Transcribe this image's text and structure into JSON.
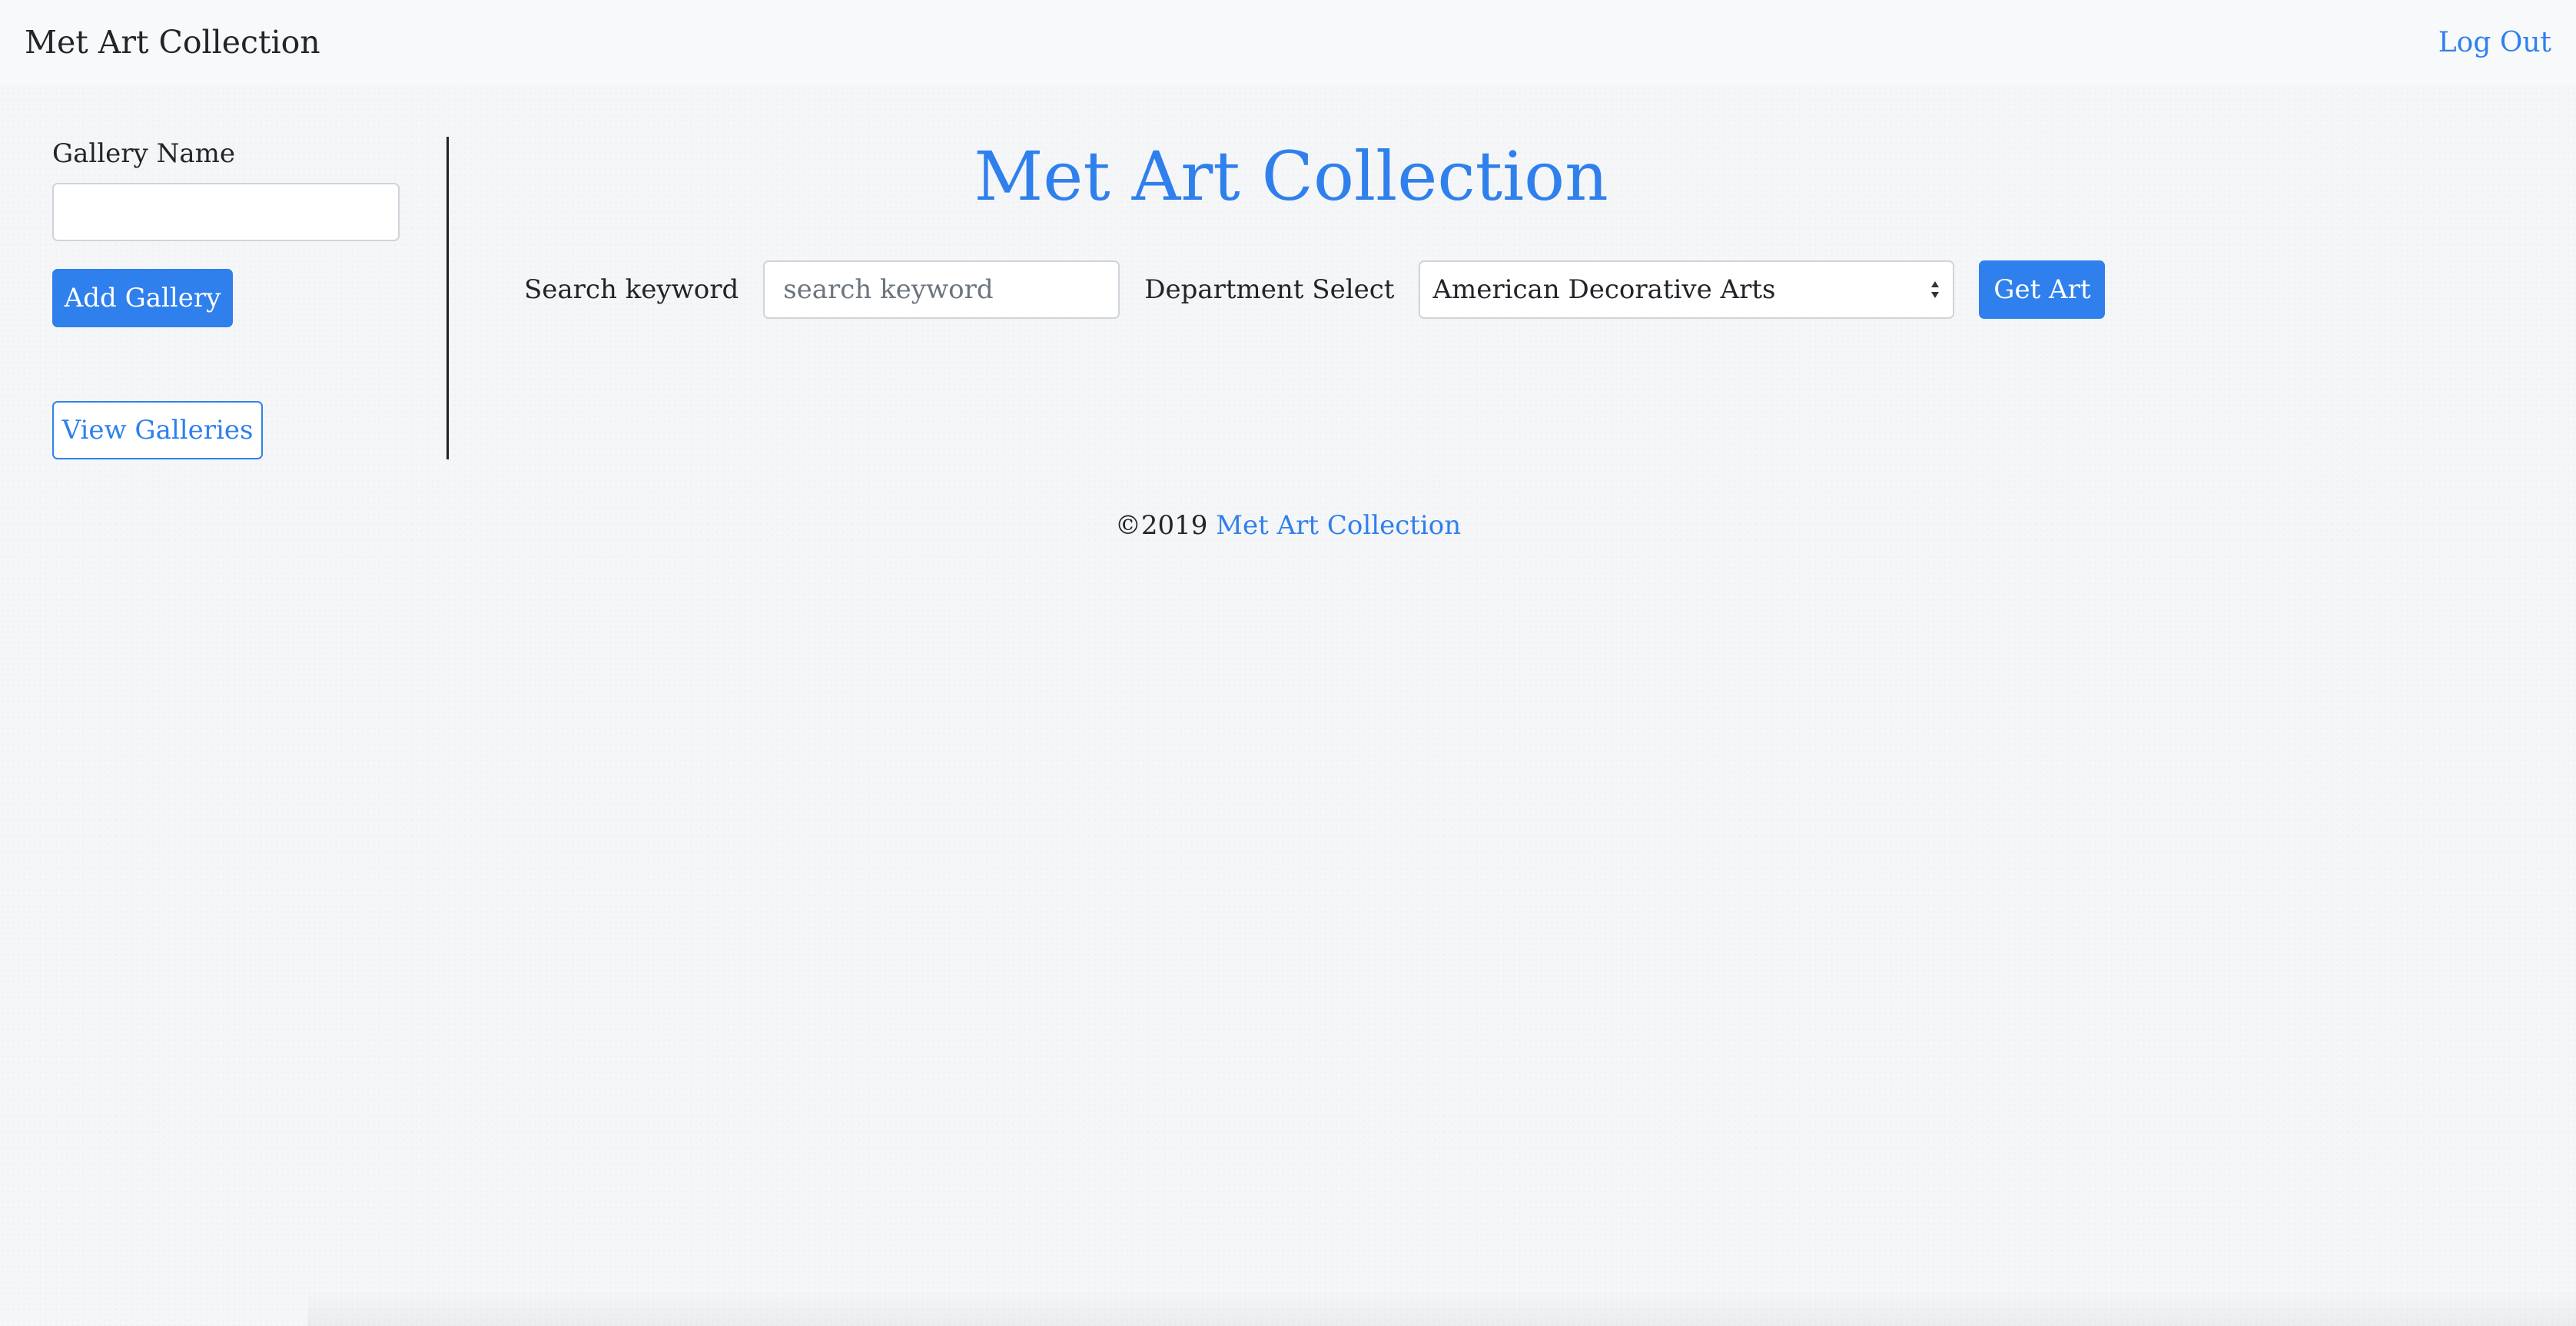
{
  "navbar": {
    "brand": "Met Art Collection",
    "logout_label": "Log Out"
  },
  "sidebar": {
    "gallery_name_label": "Gallery Name",
    "gallery_name_value": "",
    "add_gallery_label": "Add Gallery",
    "view_galleries_label": "View Galleries"
  },
  "main": {
    "title": "Met Art Collection",
    "search_label": "Search keyword",
    "search_placeholder": "search keyword",
    "department_label": "Department Select",
    "department_selected": "American Decorative Arts",
    "get_art_label": "Get Art"
  },
  "footer": {
    "copyright": "©2019",
    "link_text": "Met Art Collection"
  },
  "colors": {
    "accent": "#2f80ed",
    "navbar_bg": "#f8f9fa",
    "page_bg": "#f5f6f7"
  },
  "icons": {
    "select_arrows": "updown-chevron-icon"
  }
}
